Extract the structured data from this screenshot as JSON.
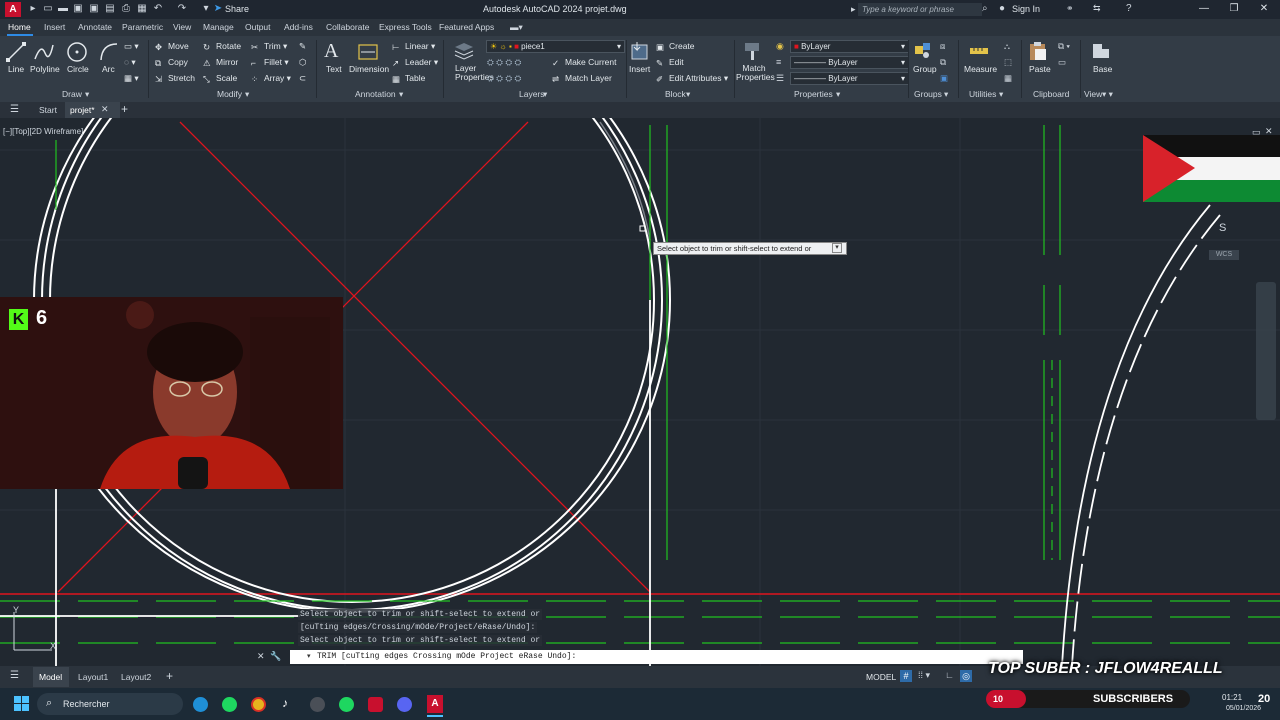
{
  "title_bar": {
    "app_logo": "A",
    "share_label": "Share",
    "title": "Autodesk AutoCAD 2024   projet.dwg",
    "search_placeholder": "Type a keyword or phrase",
    "sign_in": "Sign In"
  },
  "ribbon_tabs": [
    "Home",
    "Insert",
    "Annotate",
    "Parametric",
    "View",
    "Manage",
    "Output",
    "Add-ins",
    "Collaborate",
    "Express Tools",
    "Featured Apps"
  ],
  "draw": {
    "line": "Line",
    "polyline": "Polyline",
    "circle": "Circle",
    "arc": "Arc",
    "title": "Draw"
  },
  "modify": {
    "move": "Move",
    "rotate": "Rotate",
    "trim": "Trim",
    "copy": "Copy",
    "mirror": "Mirror",
    "fillet": "Fillet",
    "stretch": "Stretch",
    "scale": "Scale",
    "array": "Array",
    "title": "Modify"
  },
  "annotation": {
    "text": "Text",
    "dimension": "Dimension",
    "linear": "Linear",
    "leader": "Leader",
    "table": "Table",
    "title": "Annotation"
  },
  "layers": {
    "layer_properties": "Layer Properties",
    "current_layer": "piece1",
    "make_current": "Make Current",
    "match_layer": "Match Layer",
    "title": "Layers"
  },
  "block": {
    "insert": "Insert",
    "create": "Create",
    "edit": "Edit",
    "edit_attributes": "Edit Attributes",
    "title": "Block"
  },
  "properties": {
    "match_properties": "Match Properties",
    "color": "ByLayer",
    "linetype": "ByLayer",
    "lineweight": "ByLayer",
    "title": "Properties"
  },
  "groups": {
    "group": "Group",
    "title": "Groups"
  },
  "utilities": {
    "measure": "Measure",
    "title": "Utilities"
  },
  "clipboard": {
    "paste": "Paste",
    "title": "Clipboard"
  },
  "view_panel": {
    "base": "Base",
    "title": "View"
  },
  "file_tabs": {
    "start": "Start",
    "current": "projet*"
  },
  "viewport": {
    "label": "[−][Top][2D Wireframe]",
    "compass_letter": "S",
    "wcs": "WCS"
  },
  "tooltip": "Select object to trim or shift-select to extend or",
  "command_history": [
    "Select object to trim or shift-select to extend or",
    "[cuTting edges/Crossing/mOde/Project/eRase/Undo]:",
    "Select object to trim or shift-select to extend or"
  ],
  "command_line": {
    "prompt": "TRIM",
    "options": "[cuTting edges Crossing mOde Project eRase Undo]:"
  },
  "layout_tabs": [
    "Model",
    "Layout1",
    "Layout2"
  ],
  "status": {
    "model": "MODEL"
  },
  "overlay": {
    "kick_count": "6",
    "top_suber": "TOP SUBER : JFLOW4REALLL",
    "sub_count": "10",
    "subscribers": "SUBSCRIBERS",
    "sub_goal": "20"
  },
  "taskbar": {
    "search": "Rechercher",
    "time": "01:21",
    "date": "05/01/2026"
  },
  "colors": {
    "accent": "#2e8be6",
    "autocad_red": "#c8102e",
    "drawing_red": "#e0141e",
    "drawing_green": "#21c121",
    "kick_green": "#53fc18"
  }
}
